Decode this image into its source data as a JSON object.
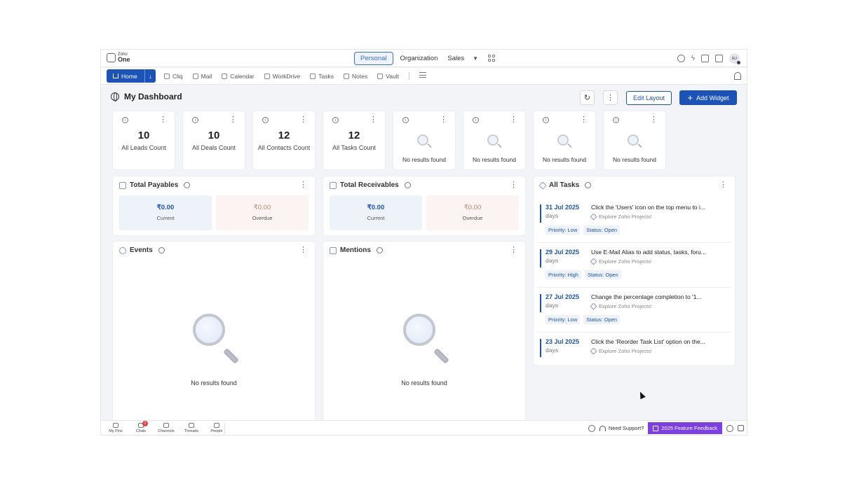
{
  "topbar": {
    "logo_small": "Zoho",
    "logo_main": "One",
    "scopes": [
      "Personal",
      "Organization",
      "Sales"
    ],
    "active_scope": "Personal",
    "avatar_initials": "RJ"
  },
  "nav": {
    "home_label": "Home",
    "items": [
      {
        "label": "Cliq",
        "icon": "cliq-icon"
      },
      {
        "label": "Mail",
        "icon": "mail-icon"
      },
      {
        "label": "Calendar",
        "icon": "calendar-icon"
      },
      {
        "label": "WorkDrive",
        "icon": "workdrive-icon"
      },
      {
        "label": "Tasks",
        "icon": "tasks-icon"
      },
      {
        "label": "Notes",
        "icon": "notes-icon"
      },
      {
        "label": "Vault",
        "icon": "vault-icon"
      }
    ]
  },
  "dashboard": {
    "title": "My Dashboard",
    "edit_layout": "Edit Layout",
    "add_widget": "Add Widget"
  },
  "count_cards": [
    {
      "value": "10",
      "label": "All Leads Count"
    },
    {
      "value": "10",
      "label": "All Deals Count"
    },
    {
      "value": "12",
      "label": "All Contacts Count"
    },
    {
      "value": "12",
      "label": "All Tasks Count"
    },
    {
      "empty": "No results found"
    },
    {
      "empty": "No results found"
    },
    {
      "empty": "No results found"
    },
    {
      "empty": "No results found"
    }
  ],
  "payables": {
    "title": "Total Payables",
    "current_amount": "₹0.00",
    "current_label": "Current",
    "overdue_amount": "₹0.00",
    "overdue_label": "Overdue"
  },
  "receivables": {
    "title": "Total Receivables",
    "current_amount": "₹0.00",
    "current_label": "Current",
    "overdue_amount": "₹0.00",
    "overdue_label": "Overdue"
  },
  "events": {
    "title": "Events",
    "empty": "No results found"
  },
  "mentions": {
    "title": "Mentions",
    "empty": "No results found"
  },
  "tasks": {
    "title": "All Tasks",
    "items": [
      {
        "date": "31 Jul 2025",
        "days": "days",
        "title": "Click the 'Users' icon on the top menu to i...",
        "project": "Explore Zoho Projects!",
        "priority": "Priority: Low",
        "status": "Status: Open"
      },
      {
        "date": "29 Jul 2025",
        "days": "days",
        "title": "Use E-Mail Alias to add status, tasks, foru...",
        "project": "Explore Zoho Projects!",
        "priority": "Priority: High",
        "status": "Status: Open"
      },
      {
        "date": "27 Jul 2025",
        "days": "days",
        "title": "Change the percentage completion to '1...",
        "project": "Explore Zoho Projects!",
        "priority": "Priority: Low",
        "status": "Status: Open"
      },
      {
        "date": "23 Jul 2025",
        "days": "days",
        "title": "Click the 'Reorder Task List' option on the...",
        "project": "Explore Zoho Projects!"
      }
    ]
  },
  "bottombar": {
    "items": [
      {
        "label": "My Pins"
      },
      {
        "label": "Chats",
        "badge": "1"
      },
      {
        "label": "Channels"
      },
      {
        "label": "Threads"
      },
      {
        "label": "People"
      }
    ],
    "support": "Need Support?",
    "feedback": "2025 Feature Feedback"
  },
  "colors": {
    "accent": "#1c53b8",
    "feedback": "#7b3fe4",
    "overdue": "#b9876e"
  }
}
